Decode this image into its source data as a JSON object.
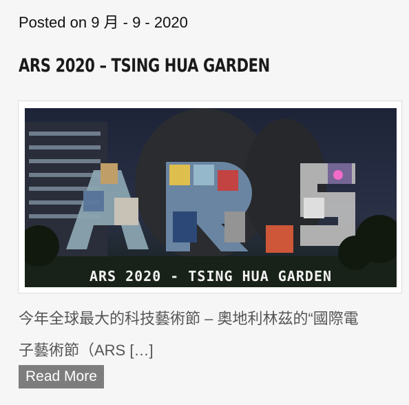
{
  "post": {
    "meta": "Posted on 9 月 - 9 - 2020",
    "title": "ARS 2020 – TSING HUA GARDEN",
    "image_caption": "ARS 2020 - TSING HUA GARDEN",
    "image_logo_text": "ARS",
    "excerpt_line1": "今年全球最大的科技藝術節 – 奧地利林茲的“國際電",
    "excerpt_line2": "子藝術節（ARS […]",
    "read_more": "Read More"
  },
  "colors": {
    "background": "#f6f6f6",
    "button": "#7d7d7d",
    "excerpt": "#555555"
  }
}
